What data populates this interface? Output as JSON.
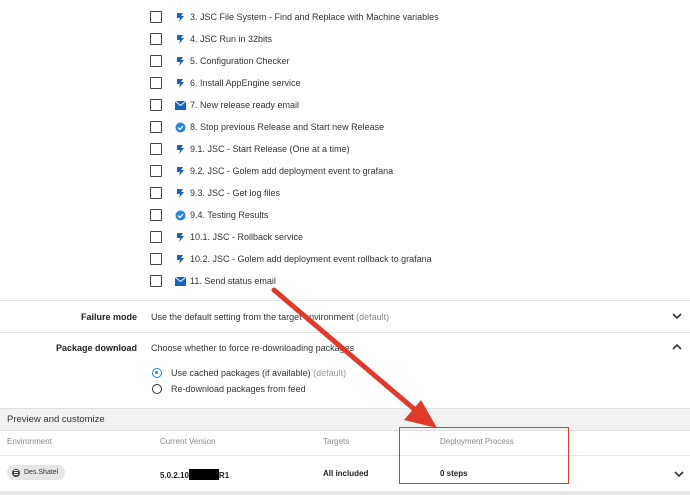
{
  "steps": [
    {
      "label": "3. JSC File System - Find and Replace with Machine variables",
      "icon": "script-step-icon"
    },
    {
      "label": "4. JSC Run in 32bits",
      "icon": "script-step-icon"
    },
    {
      "label": "5. Configuration Checker",
      "icon": "script-step-icon"
    },
    {
      "label": "6. Install AppEngine service",
      "icon": "script-step-icon"
    },
    {
      "label": "7. New release ready email",
      "icon": "email-icon"
    },
    {
      "label": "8. Stop previous Release and Start new Release",
      "icon": "check-badge-icon"
    },
    {
      "label": "9.1. JSC - Start Release (One at a time)",
      "icon": "script-step-icon"
    },
    {
      "label": "9.2. JSC - Golem add deployment event to grafana",
      "icon": "script-step-icon"
    },
    {
      "label": "9.3. JSC - Get log files",
      "icon": "script-step-icon"
    },
    {
      "label": "9.4. Testing Results",
      "icon": "check-badge-icon"
    },
    {
      "label": "10.1. JSC - Rollback service",
      "icon": "script-step-icon"
    },
    {
      "label": "10.2. JSC - Golem add deployment event rollback to grafana",
      "icon": "script-step-icon"
    },
    {
      "label": "11. Send status email",
      "icon": "email-icon"
    }
  ],
  "failure_mode": {
    "label": "Failure mode",
    "value": "Use the default setting from the target environment",
    "hint": "(default)"
  },
  "package_download": {
    "label": "Package download",
    "description": "Choose whether to force re-downloading packages",
    "options": [
      {
        "label": "Use cached packages (if available)",
        "hint": "(default)",
        "selected": true
      },
      {
        "label": "Re-download packages from feed",
        "hint": "",
        "selected": false
      }
    ]
  },
  "preview": {
    "title": "Preview and customize",
    "columns": [
      "Environment",
      "Current Version",
      "Targets",
      "Deployment Process"
    ],
    "row": {
      "environment": "Des.Shatel",
      "version_prefix": "5.0.2.10",
      "version_suffix": "R1",
      "targets": "All included",
      "process": "0 steps"
    }
  },
  "colors": {
    "accent": "#1e88e5",
    "annotation": "#e03a2a",
    "step_icon": "#1565c0"
  }
}
